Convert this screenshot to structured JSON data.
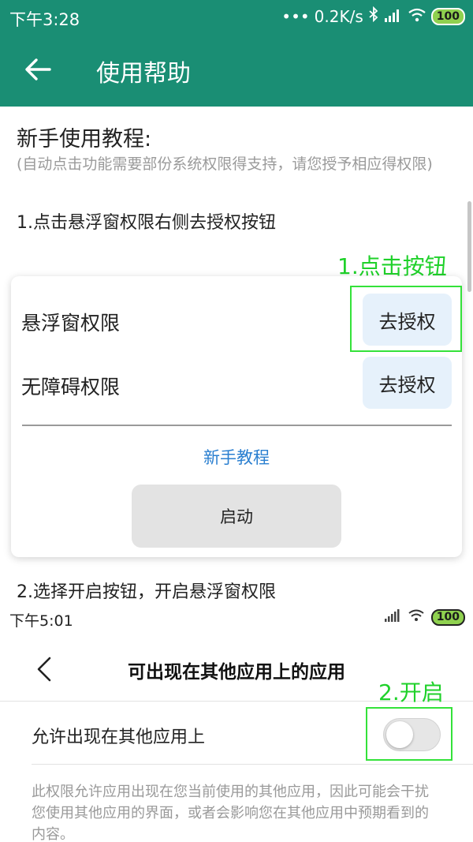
{
  "status_bar_top": {
    "time": "下午3:28",
    "net_speed": "0.2K/s",
    "battery": "100"
  },
  "app_bar": {
    "title": "使用帮助"
  },
  "content": {
    "heading": "新手使用教程:",
    "note": "(自动点击功能需要部份系统权限得支持，请您授予相应得权限)",
    "step1": "1.点击悬浮窗权限右侧去授权按钮",
    "annotation1": "1.点击按钮",
    "card": {
      "overlay_label": "悬浮窗权限",
      "overlay_button": "去授权",
      "accessibility_label": "无障碍权限",
      "accessibility_button": "去授权",
      "tutorial_link": "新手教程",
      "start_button": "启动"
    },
    "step2": "2.选择开启按钮，开启悬浮窗权限"
  },
  "status_bar_inner": {
    "time": "下午5:01",
    "battery": "100"
  },
  "settings": {
    "title": "可出现在其他应用上的应用",
    "annotation2": "2.开启",
    "allow_label": "允许出现在其他应用上",
    "allow_on": false,
    "description": "此权限允许应用出现在您当前使用的其他应用，因此可能会干扰您使用其他应用的界面，或者会影响您在其他应用中预期看到的内容。"
  }
}
